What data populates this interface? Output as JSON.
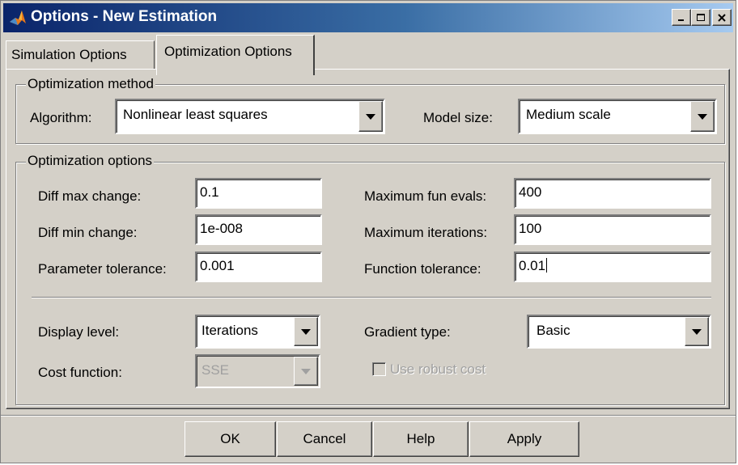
{
  "window": {
    "title": "Options - New Estimation"
  },
  "tabs": [
    {
      "label": "Simulation Options",
      "active": false
    },
    {
      "label": "Optimization Options",
      "active": true
    }
  ],
  "optimization_method": {
    "legend": "Optimization method",
    "algorithm_label": "Algorithm:",
    "algorithm_value": "Nonlinear least squares",
    "model_size_label": "Model size:",
    "model_size_value": "Medium scale"
  },
  "optimization_options": {
    "legend": "Optimization options",
    "diff_max_change_label": "Diff max change:",
    "diff_max_change_value": "0.1",
    "diff_min_change_label": "Diff min change:",
    "diff_min_change_value": "1e-008",
    "parameter_tolerance_label": "Parameter tolerance:",
    "parameter_tolerance_value": "0.001",
    "max_fun_evals_label": "Maximum fun evals:",
    "max_fun_evals_value": "400",
    "max_iterations_label": "Maximum iterations:",
    "max_iterations_value": "100",
    "function_tolerance_label": "Function tolerance:",
    "function_tolerance_value": "0.01",
    "display_level_label": "Display level:",
    "display_level_value": "Iterations",
    "gradient_type_label": "Gradient type:",
    "gradient_type_value": "Basic",
    "cost_function_label": "Cost function:",
    "cost_function_value": "SSE",
    "use_robust_cost_label": "Use robust cost",
    "use_robust_cost_checked": false
  },
  "buttons": {
    "ok": "OK",
    "cancel": "Cancel",
    "help": "Help",
    "apply": "Apply"
  },
  "colors": {
    "face": "#d4d0c8",
    "title_start": "#0a246a",
    "title_end": "#a6caf0",
    "disabled_text": "#a0a0a0"
  }
}
